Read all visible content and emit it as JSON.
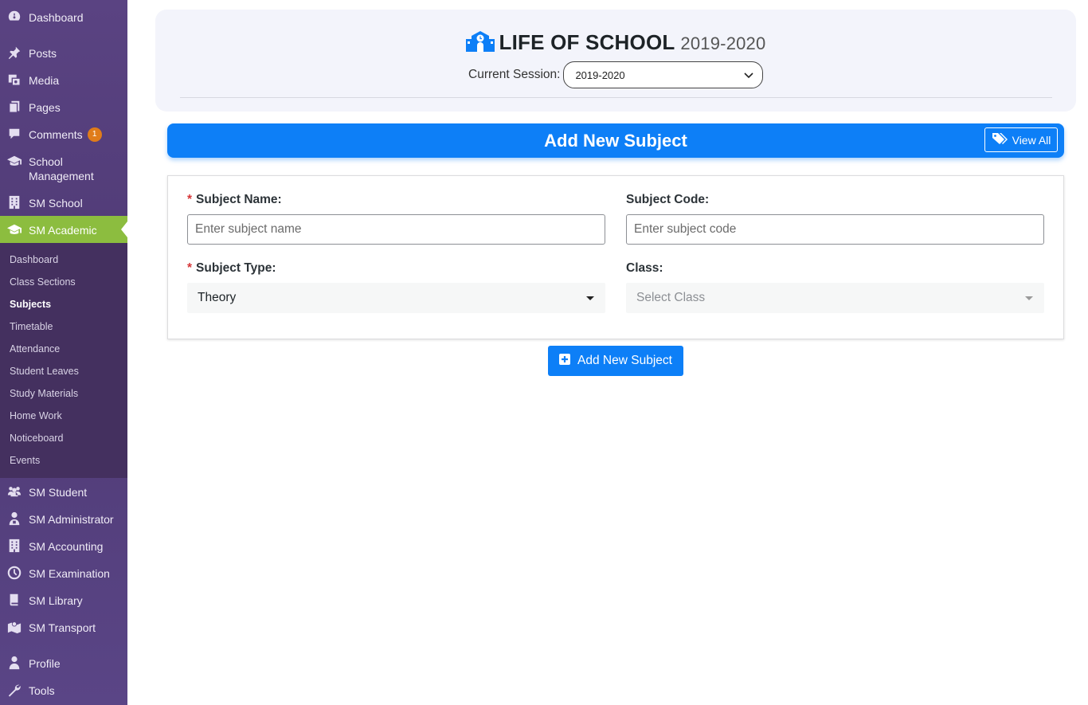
{
  "sidebar": {
    "items": [
      {
        "label": "Dashboard",
        "icon": "dashboard-icon"
      },
      {
        "label": "Posts",
        "icon": "pin-icon"
      },
      {
        "label": "Media",
        "icon": "media-icon"
      },
      {
        "label": "Pages",
        "icon": "pages-icon"
      },
      {
        "label": "Comments",
        "icon": "comment-icon",
        "badge": "1"
      },
      {
        "label": "School Management",
        "icon": "graduation-cap-icon"
      },
      {
        "label": "SM School",
        "icon": "building-icon"
      },
      {
        "label": "SM Academic",
        "icon": "graduation-cap-icon",
        "active": true
      },
      {
        "label": "SM Student",
        "icon": "users-icon"
      },
      {
        "label": "SM Administrator",
        "icon": "admin-user-icon"
      },
      {
        "label": "SM Accounting",
        "icon": "building-icon"
      },
      {
        "label": "SM Examination",
        "icon": "clock-icon"
      },
      {
        "label": "SM Library",
        "icon": "book-icon"
      },
      {
        "label": "SM Transport",
        "icon": "map-icon"
      },
      {
        "label": "Profile",
        "icon": "user-icon"
      },
      {
        "label": "Tools",
        "icon": "wrench-icon"
      }
    ],
    "submenu": [
      {
        "label": "Dashboard"
      },
      {
        "label": "Class Sections"
      },
      {
        "label": "Subjects",
        "current": true
      },
      {
        "label": "Timetable"
      },
      {
        "label": "Attendance"
      },
      {
        "label": "Student Leaves"
      },
      {
        "label": "Study Materials"
      },
      {
        "label": "Home Work"
      },
      {
        "label": "Noticeboard"
      },
      {
        "label": "Events"
      }
    ]
  },
  "header": {
    "school_name": "LIFE OF SCHOOL",
    "session_year": "2019-2020",
    "session_label": "Current Session:",
    "session_value": "2019-2020",
    "icon": "school-icon"
  },
  "banner": {
    "title": "Add New Subject",
    "view_all_label": "View All",
    "view_all_icon": "tags-icon"
  },
  "form": {
    "subject_name": {
      "label": "Subject Name:",
      "required": "*",
      "placeholder": "Enter subject name",
      "value": ""
    },
    "subject_code": {
      "label": "Subject Code:",
      "placeholder": "Enter subject code",
      "value": ""
    },
    "subject_type": {
      "label": "Subject Type:",
      "required": "*",
      "value": "Theory"
    },
    "class": {
      "label": "Class:",
      "placeholder": "Select Class"
    },
    "submit_label": "Add New Subject",
    "submit_icon": "plus-square-icon"
  },
  "colors": {
    "sidebar_bg": "#5a4382",
    "submenu_bg": "#44305f",
    "active_item": "#8cbd3f",
    "primary": "#0d7ff7",
    "badge": "#e07c1a",
    "required": "#d63638"
  }
}
